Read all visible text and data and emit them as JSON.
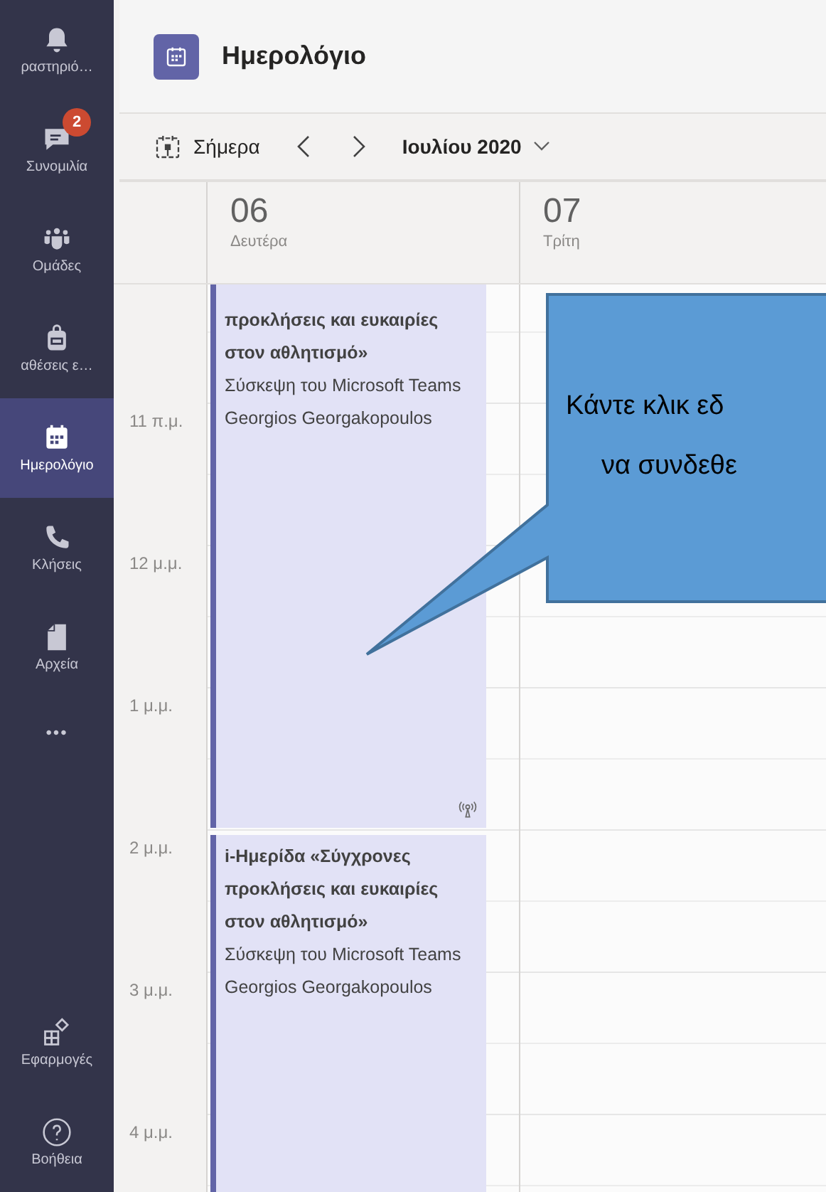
{
  "sidebar": {
    "items": [
      {
        "kind": "bell",
        "label": "ραστηριό…",
        "selected": false
      },
      {
        "kind": "chat",
        "label": "Συνομιλία",
        "badge": "2",
        "selected": false
      },
      {
        "kind": "teams",
        "label": "Ομάδες",
        "selected": false
      },
      {
        "kind": "bag",
        "label": "αθέσεις ε…",
        "selected": false
      },
      {
        "kind": "calendar",
        "label": "Ημερολόγιο",
        "selected": true
      },
      {
        "kind": "phone",
        "label": "Κλήσεις",
        "selected": false
      },
      {
        "kind": "file",
        "label": "Αρχεία",
        "selected": false
      },
      {
        "kind": "more",
        "label": "•••",
        "selected": false
      }
    ],
    "bottom_items": [
      {
        "kind": "apps",
        "label": "Εφαρμογές",
        "selected": false
      },
      {
        "kind": "help",
        "label": "Βοήθεια",
        "selected": false
      }
    ]
  },
  "header": {
    "title": "Ημερολόγιο"
  },
  "toolbar": {
    "today": "Σήμερα",
    "month": "Ιουλίου 2020"
  },
  "days": [
    {
      "number": "06",
      "weekday": "Δευτέρα"
    },
    {
      "number": "07",
      "weekday": "Τρίτη"
    }
  ],
  "hours": [
    "11 π.μ.",
    "12 μ.μ.",
    "1 μ.μ.",
    "2 μ.μ.",
    "3 μ.μ.",
    "4 μ.μ."
  ],
  "events": [
    {
      "title": "προκλήσεις και ευκαιρίες στον αθλητισμό»",
      "type": "Σύσκεψη του Microsoft Teams",
      "organizer": "Georgios Georgakopoulos",
      "live": true
    },
    {
      "title": "i-Ημερίδα «Σύγχρονες προκλήσεις και ευκαιρίες στον αθλητισμό»",
      "type": "Σύσκεψη του Microsoft Teams",
      "organizer": "Georgios Georgakopoulos",
      "live": false
    }
  ],
  "callout": {
    "lines": [
      "Κάντε κλικ εδ",
      "να συνδεθε"
    ]
  }
}
